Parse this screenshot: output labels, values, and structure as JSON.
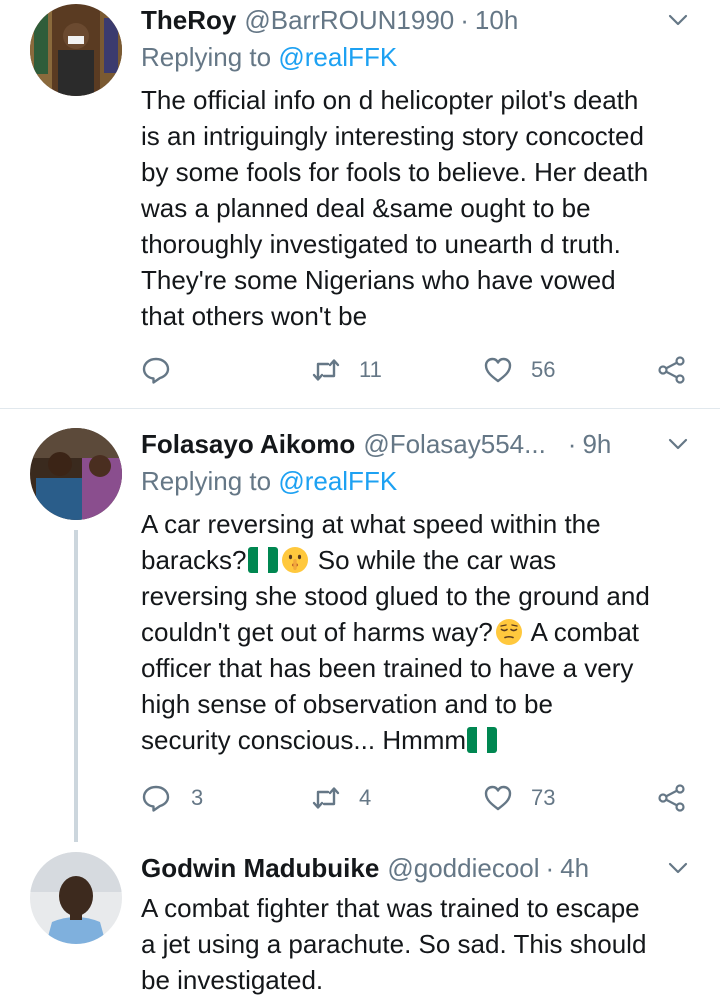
{
  "tweets": [
    {
      "display_name": "TheRoy",
      "handle": "@BarrROUN1990",
      "time": "10h",
      "replying_label": "Replying to",
      "replying_to": "@realFFK",
      "body_lines": [
        "The official info on d helicopter pilot's death",
        "is an intriguingly interesting story concocted",
        "by some fools for fools to believe. Her death",
        "was a planned deal &same ought to be",
        "thoroughly investigated to unearth d truth.",
        "They're some Nigerians who have vowed",
        "that others won't be"
      ],
      "replies": "",
      "retweets": "11",
      "likes": "56"
    },
    {
      "display_name": "Folasayo Aikomo",
      "handle": "@Folasay554...",
      "time": "9h",
      "replying_label": "Replying to",
      "replying_to": "@realFFK",
      "body": {
        "l1": "A car reversing at what speed within the",
        "l2a": "baracks?",
        "l2b": " So while the car was",
        "l3": "reversing she stood glued to the ground and",
        "l4a": "couldn't get out of harms way?",
        "l4b": " A combat",
        "l5": "officer that has been trained to have a very",
        "l6": "high sense of observation  and to be",
        "l7": "security conscious...  Hmmm"
      },
      "replies": "3",
      "retweets": "4",
      "likes": "73"
    },
    {
      "display_name": "Godwin Madubuike",
      "handle": "@goddiecool",
      "time": "4h",
      "body_lines": [
        "A combat fighter that was trained to escape",
        "a jet  using a parachute. So sad. This should",
        "be investigated."
      ]
    }
  ],
  "icons": {
    "reply": "reply-icon",
    "retweet": "retweet-icon",
    "like": "heart-icon",
    "share": "share-icon",
    "more": "chevron-down-icon",
    "flag": "nigeria-flag-emoji",
    "shush": "shushing-face-emoji",
    "pensive": "relieved-face-emoji"
  },
  "colors": {
    "text": "#14171a",
    "secondary": "#657786",
    "link": "#1da1f2",
    "flag_green": "#008751",
    "divider": "#e1e8ed"
  }
}
